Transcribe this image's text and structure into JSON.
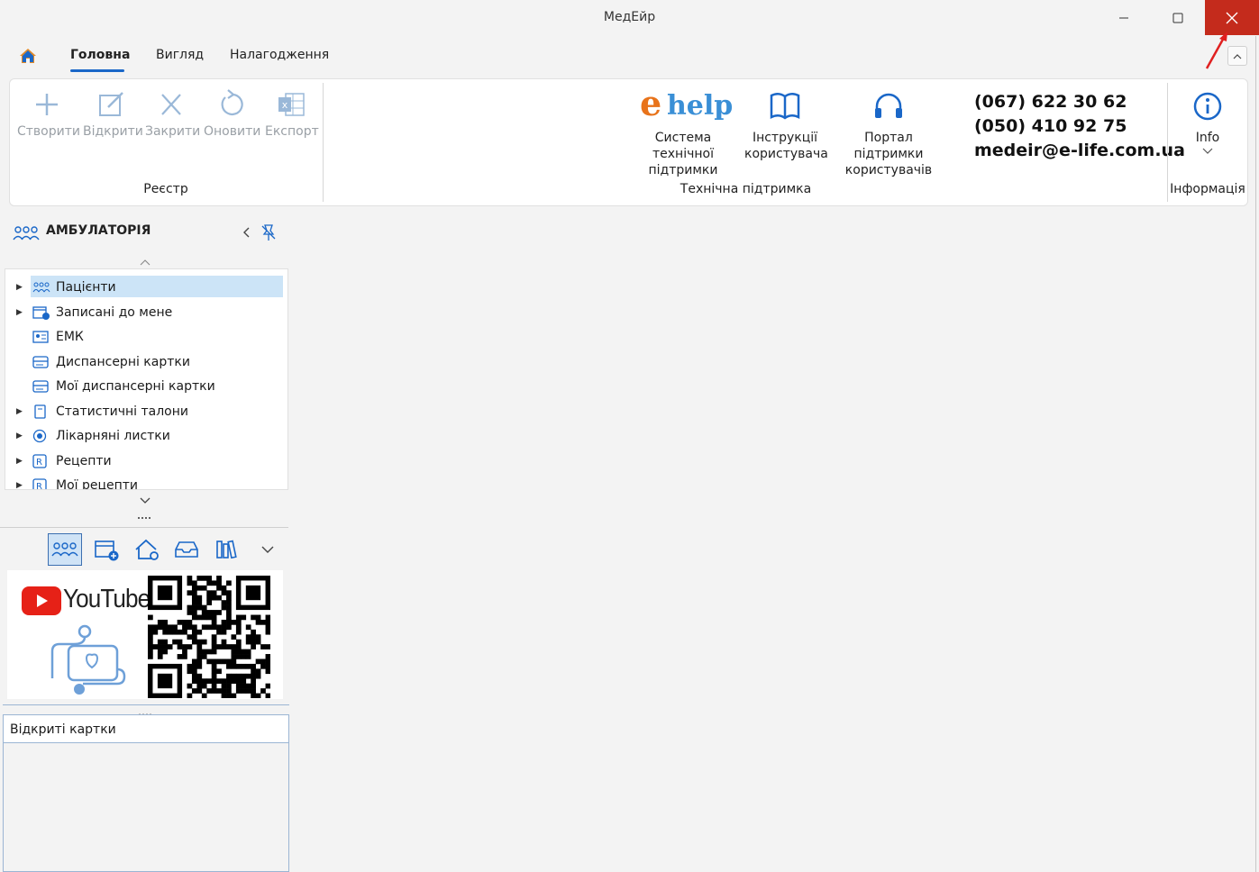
{
  "window": {
    "title": "МедЕйр"
  },
  "tabs": [
    "Головна",
    "Вигляд",
    "Налагодження"
  ],
  "ribbon": {
    "registry": {
      "buttons": [
        "Створити",
        "Відкрити",
        "Закрити",
        "Оновити",
        "Експорт"
      ],
      "group_label": "Реєстр"
    },
    "support": {
      "ehelp_logo": "help",
      "ehelp_letter": "e",
      "system_label": [
        "Система технічної",
        "підтримки"
      ],
      "manuals_label": [
        "Інструкції",
        "користувача"
      ],
      "portal_label": [
        "Портал підтримки",
        "користувачів"
      ],
      "phone1": "(067) 622 30 62",
      "phone2": "(050) 410 92 75",
      "email": "medeir@e-life.com.ua",
      "group_label": "Технічна підтримка"
    },
    "info": {
      "button": "Info",
      "group_label": "Інформація"
    }
  },
  "nav": {
    "header": "АМБУЛАТОРІЯ",
    "items": [
      {
        "label": "Пацієнти",
        "expandable": true,
        "selected": true,
        "icon": "patients-icon"
      },
      {
        "label": "Записані до мене",
        "expandable": true,
        "icon": "calendar-add-icon"
      },
      {
        "label": "ЕМК",
        "expandable": false,
        "icon": "id-card-icon"
      },
      {
        "label": "Диспансерні картки",
        "expandable": false,
        "icon": "card-icon"
      },
      {
        "label": "Мої диспансерні картки",
        "expandable": false,
        "icon": "card-icon"
      },
      {
        "label": "Статистичні талони",
        "expandable": true,
        "icon": "document-icon"
      },
      {
        "label": "Лікарняні листки",
        "expandable": true,
        "icon": "sick-leave-icon"
      },
      {
        "label": "Рецепти",
        "expandable": true,
        "icon": "prescription-icon"
      },
      {
        "label": "Мої рецепти",
        "expandable": true,
        "icon": "prescription-icon"
      }
    ]
  },
  "promo": {
    "youtube": "YouTube"
  },
  "open_cards": {
    "title": "Відкриті картки"
  },
  "colors": {
    "accent": "#1a67c8",
    "close": "#c42b1c",
    "selection": "#cce4f7",
    "ehelp_orange": "#e8731a"
  }
}
